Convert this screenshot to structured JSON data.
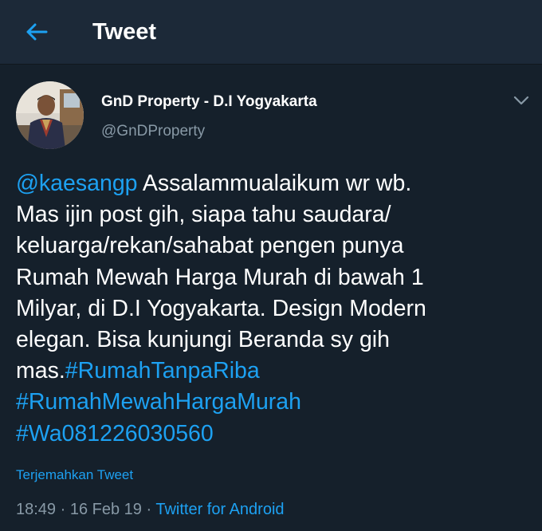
{
  "header": {
    "title": "Tweet",
    "back_icon": "arrow-left-icon",
    "accent": "#1da1f2",
    "background": "#1c2938"
  },
  "tweet": {
    "author": {
      "name": "GnD Property - D.I Yogyakarta",
      "handle": "@GnDProperty",
      "avatar": "avatar-photo"
    },
    "menu_icon": "chevron-down-icon",
    "lines": [
      {
        "parts": [
          {
            "text": "@kaesangp",
            "link": true
          },
          {
            "text": " Assalammualaikum wr wb.",
            "link": false
          }
        ]
      },
      {
        "parts": [
          {
            "text": "Mas ijin post gih, siapa tahu saudara/",
            "link": false
          }
        ]
      },
      {
        "parts": [
          {
            "text": "keluarga/rekan/sahabat  pengen punya",
            "link": false
          }
        ]
      },
      {
        "parts": [
          {
            "text": "Rumah Mewah Harga Murah di bawah 1",
            "link": false
          }
        ]
      },
      {
        "parts": [
          {
            "text": "Milyar, di D.I Yogyakarta. Design Modern",
            "link": false
          }
        ]
      },
      {
        "parts": [
          {
            "text": "elegan. Bisa kunjungi Beranda sy gih",
            "link": false
          }
        ]
      },
      {
        "parts": [
          {
            "text": "mas.",
            "link": false
          },
          {
            "text": "#RumahTanpaRiba",
            "link": true
          }
        ]
      },
      {
        "parts": [
          {
            "text": "#RumahMewahHargaMurah",
            "link": true
          }
        ]
      },
      {
        "parts": [
          {
            "text": "#Wa081226030560",
            "link": true
          }
        ]
      }
    ],
    "translate_label": "Terjemahkan Tweet",
    "time": "18:49",
    "separator": " · ",
    "date": "16 Feb 19",
    "source": "Twitter for Android"
  },
  "colors": {
    "page_bg": "#15202b",
    "secondary_text": "#8899a6",
    "link": "#1da1f2"
  }
}
